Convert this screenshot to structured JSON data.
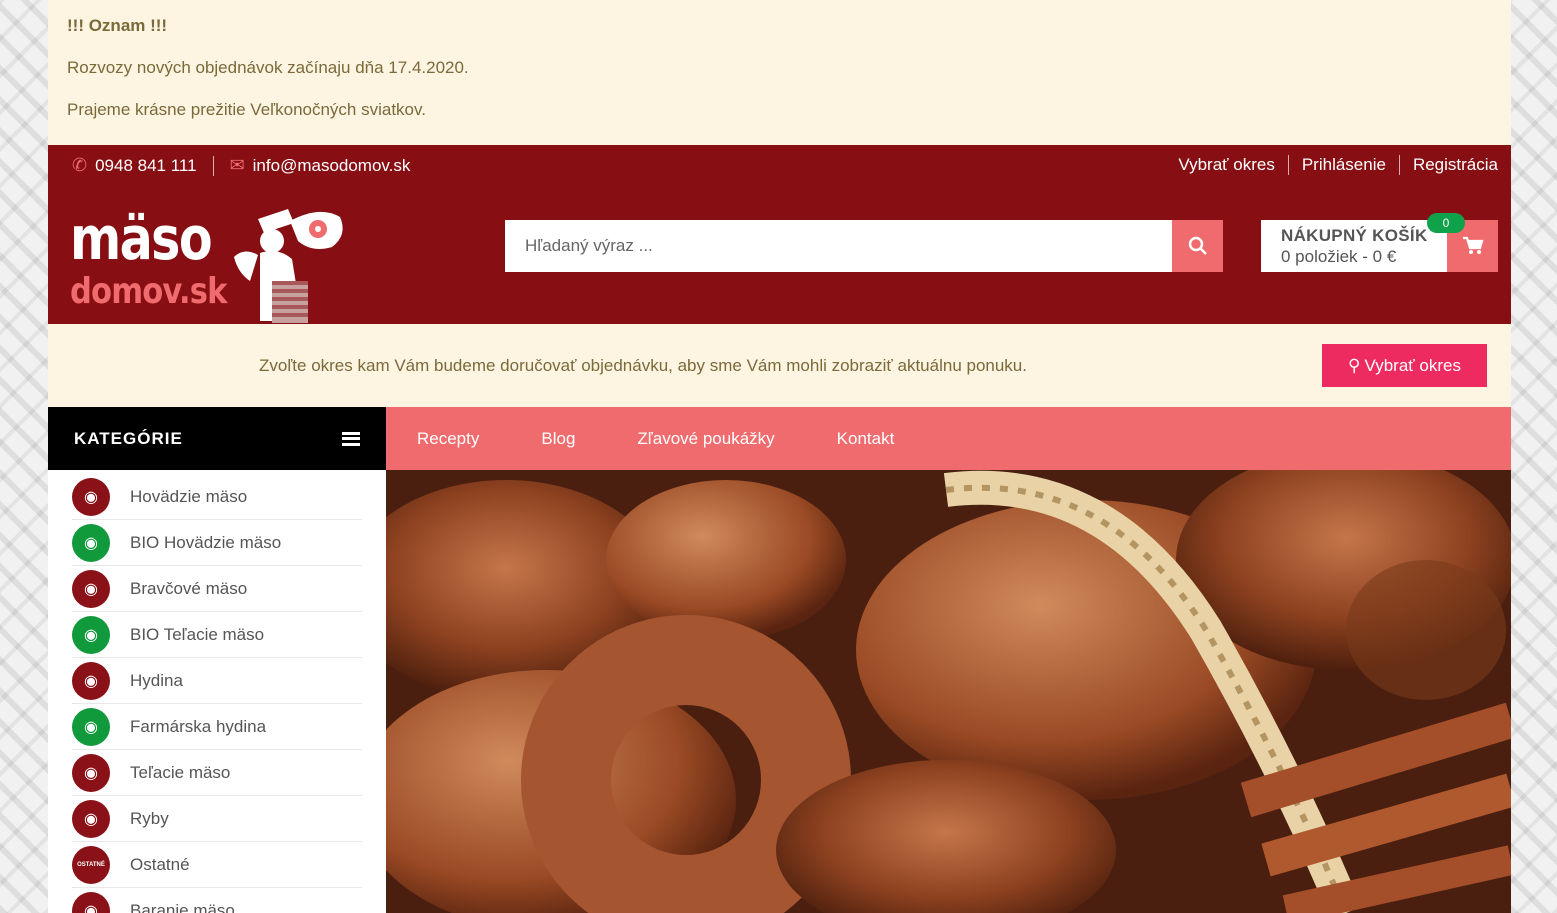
{
  "notice": {
    "title": "!!! Oznam !!!",
    "line1": "Rozvozy nových objednávok začínaju dňa 17.4.2020.",
    "line2": "Prajeme krásne prežitie Veľkonočných sviatkov."
  },
  "topbar": {
    "phone": "0948 841 111",
    "email": "info@masodomov.sk",
    "links": [
      "Vybrať okres",
      "Prihlásenie",
      "Registrácia"
    ]
  },
  "logo": {
    "line1": "mäso",
    "line2": "domov.sk"
  },
  "search": {
    "placeholder": "Hľadaný výraz ..."
  },
  "cart": {
    "title": "NÁKUPNÝ KOŠÍK",
    "info": "0 položiek - 0 €",
    "count": "0"
  },
  "district": {
    "message": "Zvoľte okres kam Vám budeme doručovať objednávku, aby sme Vám mohli zobraziť aktuálnu ponuku.",
    "button": "Vybrať okres"
  },
  "categories": {
    "heading": "KATEGÓRIE",
    "items": [
      {
        "label": "Hovädzie mäso",
        "color": "#8a1117",
        "icon": "cow-icon"
      },
      {
        "label": "BIO Hovädzie mäso",
        "color": "#109a3c",
        "icon": "cow-icon"
      },
      {
        "label": "Bravčové mäso",
        "color": "#8a1117",
        "icon": "pig-icon"
      },
      {
        "label": "BIO Teľacie mäso",
        "color": "#109a3c",
        "icon": "calf-icon"
      },
      {
        "label": "Hydina",
        "color": "#8a1117",
        "icon": "chicken-icon"
      },
      {
        "label": "Farmárska hydina",
        "color": "#109a3c",
        "icon": "chicken-icon"
      },
      {
        "label": "Teľacie mäso",
        "color": "#8a1117",
        "icon": "calf-icon"
      },
      {
        "label": "Ryby",
        "color": "#8a1117",
        "icon": "fish-icon"
      },
      {
        "label": "Ostatné",
        "color": "#8a1117",
        "icon": "other-icon",
        "icon_text": "OSTATNÉ"
      },
      {
        "label": "Baranie mäso",
        "color": "#8a1117",
        "icon": "sheep-icon"
      }
    ]
  },
  "menu": [
    "Recepty",
    "Blog",
    "Zľavové poukážky",
    "Kontakt"
  ],
  "colors": {
    "header": "#870e13",
    "accent": "#f06b6e",
    "cta": "#ee2b60",
    "notice_bg": "#fdf5e2"
  }
}
